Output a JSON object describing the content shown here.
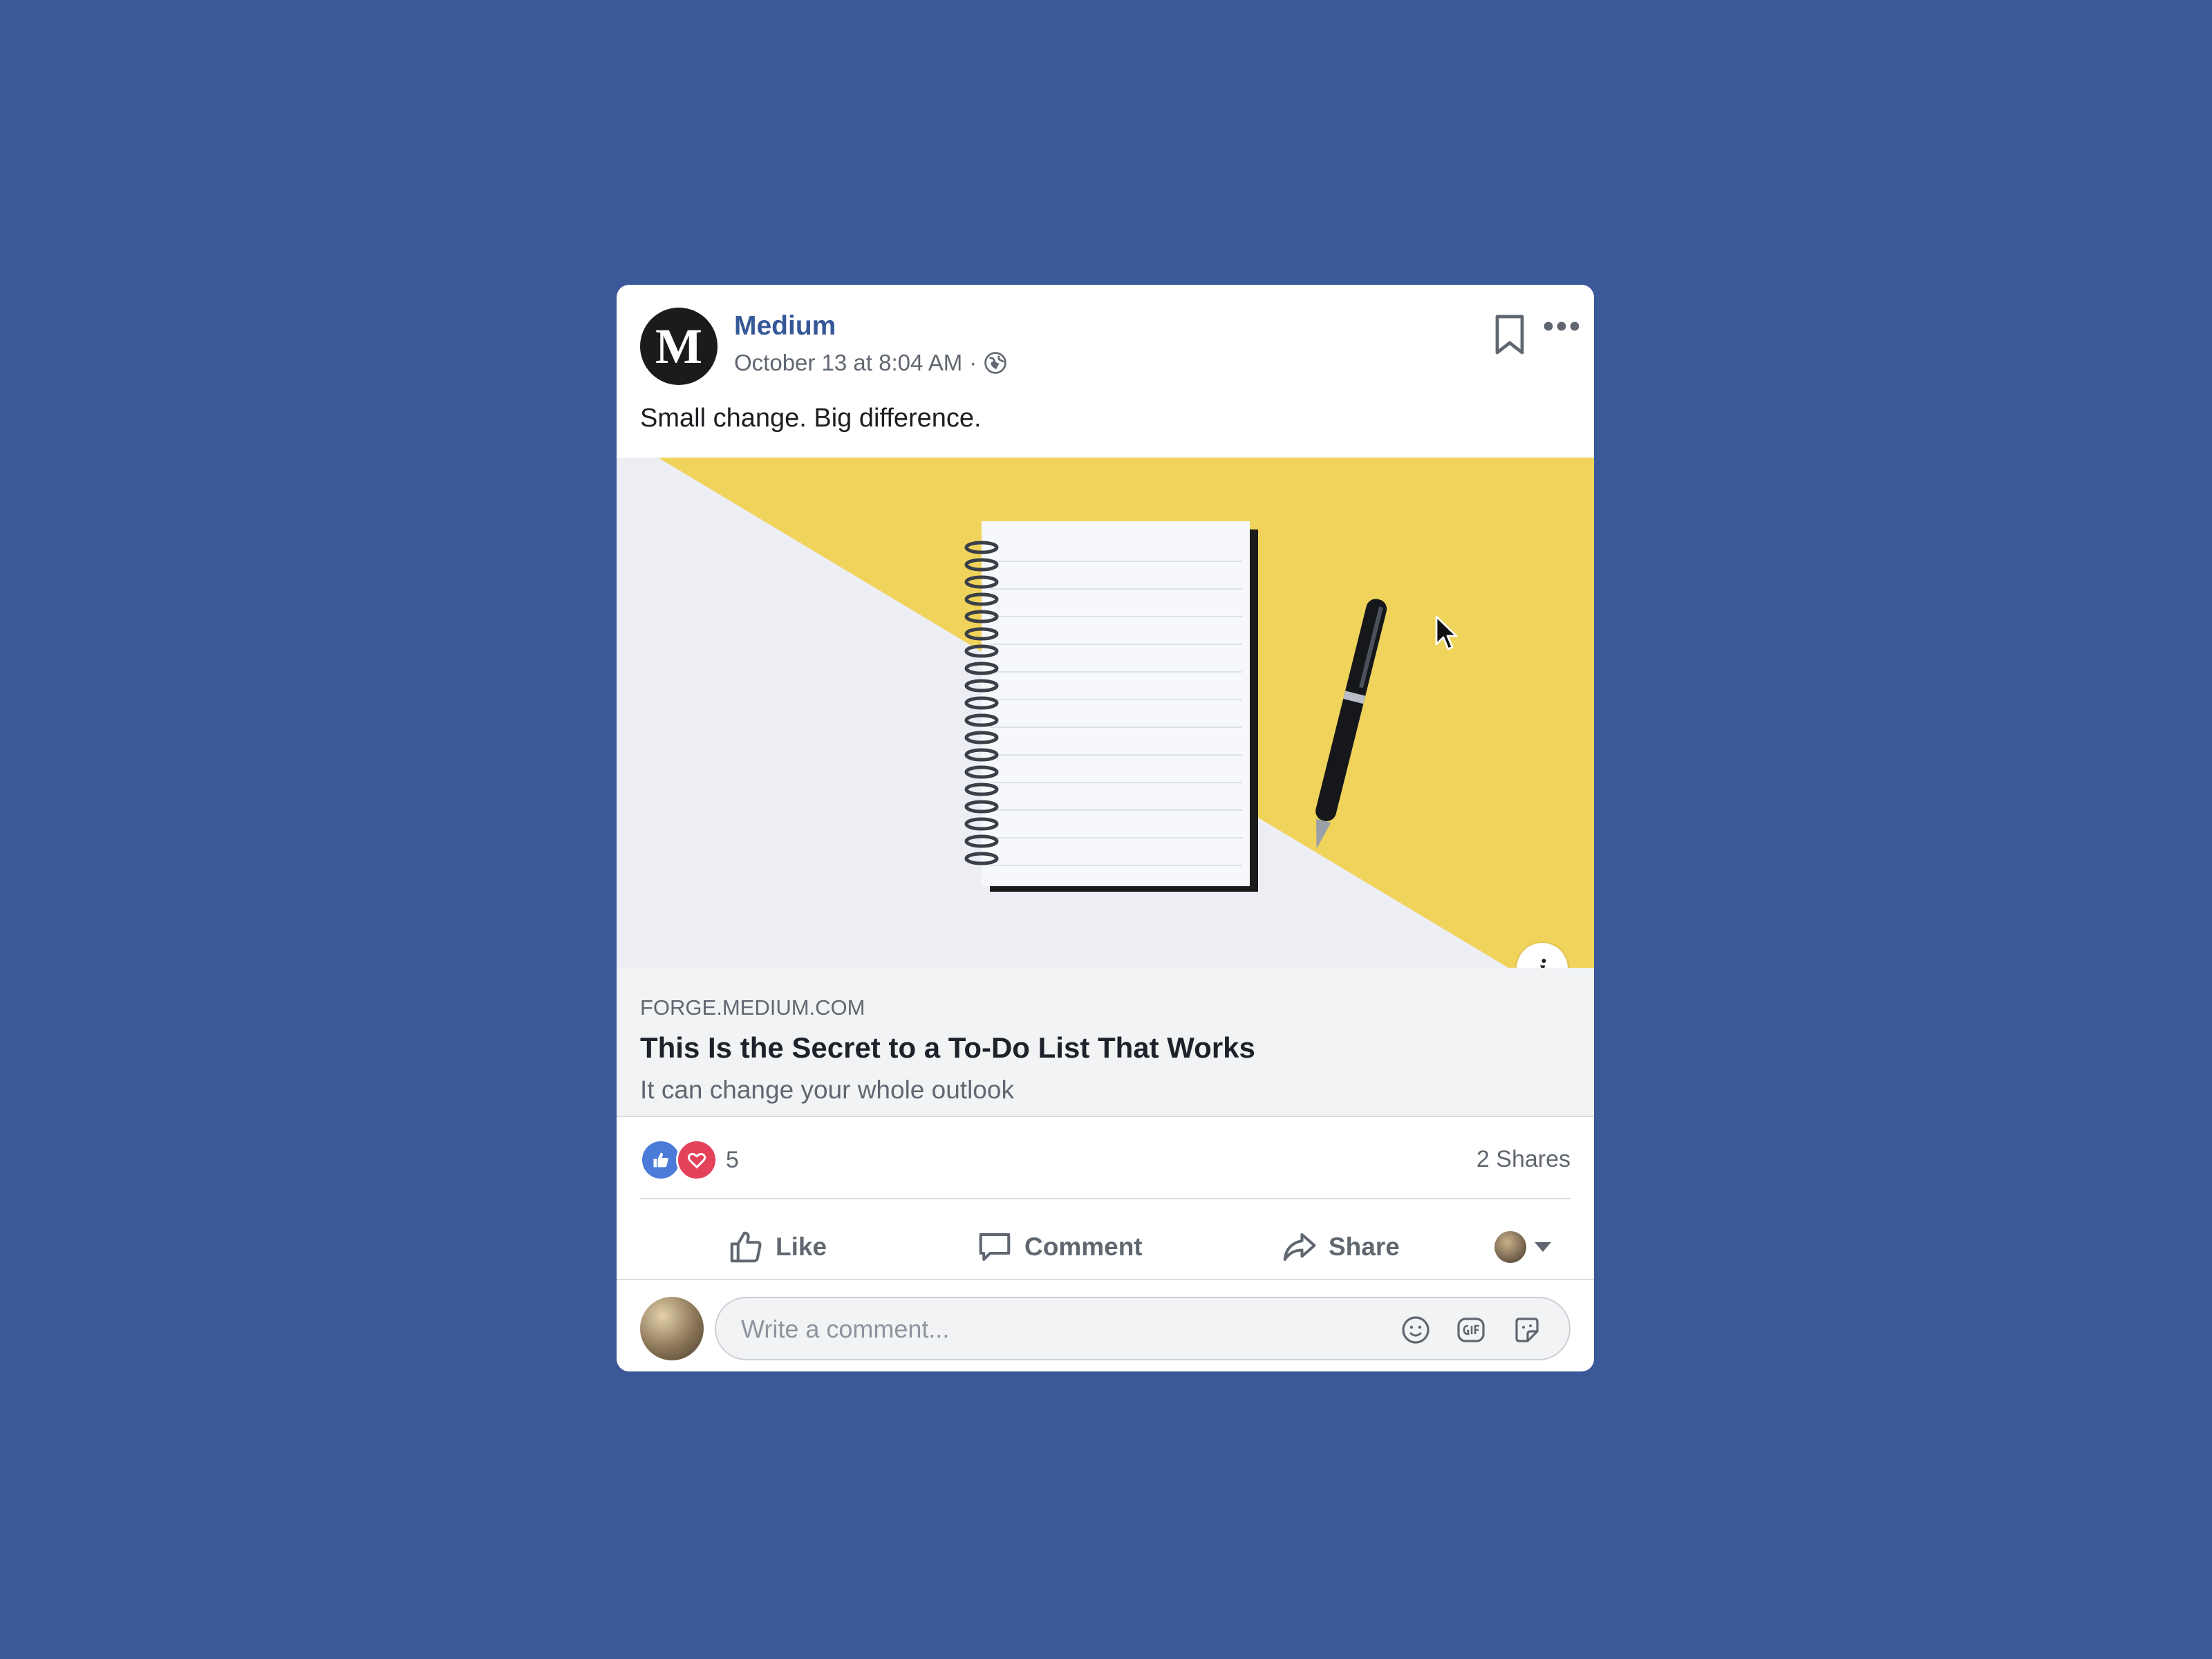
{
  "post": {
    "page_name": "Medium",
    "avatar_letter": "M",
    "timestamp": "October 13 at 8:04 AM",
    "meta_separator": "·",
    "text": "Small change. Big difference."
  },
  "link_preview": {
    "domain": "FORGE.MEDIUM.COM",
    "title": "This Is the Secret to a To-Do List That Works",
    "description": "It can change your whole outlook",
    "info_label": "i"
  },
  "engagement": {
    "reaction_count": "5",
    "shares": "2 Shares"
  },
  "actions": {
    "like": "Like",
    "comment": "Comment",
    "share": "Share"
  },
  "comment_box": {
    "placeholder": "Write a comment..."
  },
  "icons": [
    "globe-icon",
    "bookmark-icon",
    "more-icon",
    "info-icon",
    "like-reaction-icon",
    "love-reaction-icon",
    "thumbs-up-icon",
    "comment-icon",
    "share-icon",
    "caret-down-icon",
    "emoji-icon",
    "gif-icon",
    "sticker-icon",
    "mouse-cursor-icon"
  ],
  "colors": {
    "background": "#3b5998",
    "link_blue": "#365899",
    "secondary_text": "#606770",
    "image_yellow": "#f0d35a"
  }
}
